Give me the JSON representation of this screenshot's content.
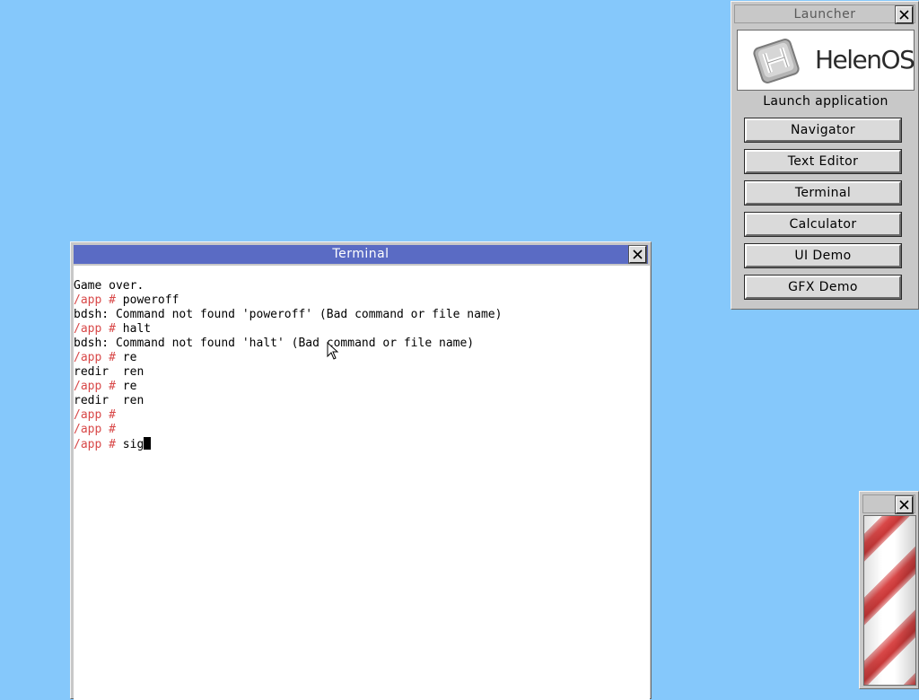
{
  "launcher": {
    "title": "Launcher",
    "logo_text": "HelenOS",
    "launch_label": "Launch application",
    "buttons": [
      "Navigator",
      "Text Editor",
      "Terminal",
      "Calculator",
      "UI Demo",
      "GFX Demo"
    ]
  },
  "terminal": {
    "title": "Terminal",
    "lines": [
      {
        "prompt": "",
        "text": "Game over."
      },
      {
        "prompt": "/app # ",
        "text": "poweroff"
      },
      {
        "prompt": "",
        "text": "bdsh: Command not found 'poweroff' (Bad command or file name)"
      },
      {
        "prompt": "/app # ",
        "text": "halt"
      },
      {
        "prompt": "",
        "text": "bdsh: Command not found 'halt' (Bad command or file name)"
      },
      {
        "prompt": "/app # ",
        "text": "re"
      },
      {
        "prompt": "",
        "text": "redir  ren"
      },
      {
        "prompt": "/app # ",
        "text": "re"
      },
      {
        "prompt": "",
        "text": "redir  ren"
      },
      {
        "prompt": "/app # ",
        "text": ""
      },
      {
        "prompt": "/app # ",
        "text": ""
      },
      {
        "prompt": "/app # ",
        "text": "sig"
      }
    ]
  },
  "colors": {
    "desktop": "#85c8fb",
    "terminal_titlebar": "#5a6bc4",
    "prompt": "#d84848"
  },
  "icons": {
    "close": "close-icon",
    "logo": "helenos-logo-icon",
    "pointer": "mouse-pointer-icon"
  }
}
